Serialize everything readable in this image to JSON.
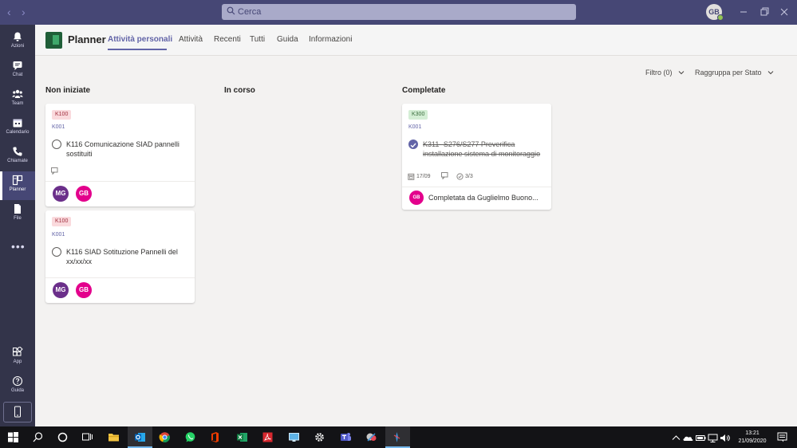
{
  "search": {
    "placeholder": "Cerca"
  },
  "user": {
    "initials": "GB"
  },
  "rail": {
    "items": [
      {
        "label": "Azioni",
        "icon": "bell-icon"
      },
      {
        "label": "Chat",
        "icon": "chat-icon"
      },
      {
        "label": "Team",
        "icon": "team-icon"
      },
      {
        "label": "Calendario",
        "icon": "calendar-icon"
      },
      {
        "label": "Chiamate",
        "icon": "phone-icon"
      },
      {
        "label": "Planner",
        "icon": "planner-icon"
      },
      {
        "label": "File",
        "icon": "file-icon"
      }
    ],
    "bottom": [
      {
        "label": "App",
        "icon": "apps-icon"
      },
      {
        "label": "Guida",
        "icon": "help-icon"
      }
    ]
  },
  "header": {
    "app_title": "Planner",
    "tabs": [
      "Attività personali",
      "Attività",
      "Recenti",
      "Tutti",
      "Guida",
      "Informazioni"
    ]
  },
  "toolbar": {
    "filter": "Filtro (0)",
    "group": "Raggruppa per Stato"
  },
  "columns": [
    "Non iniziate",
    "In corso",
    "Completate"
  ],
  "cards": [
    {
      "label": "K100",
      "bucket": "K001",
      "title": "K116 Comunicazione SIAD pannelli sostituiti",
      "assignees": [
        "MG",
        "GB"
      ]
    },
    {
      "label": "K100",
      "bucket": "K001",
      "title": "K116 SIAD Sotituzione Pannelli del xx/xx/xx",
      "assignees": [
        "MG",
        "GB"
      ]
    },
    {
      "label": "K300",
      "bucket": "K001",
      "title": "K311- S276/S277 Preverifica installazione sistema di monitoraggio",
      "due": "17/09",
      "checklist": "3/3",
      "completed_by_initials": "GB",
      "completed_by": "Completata da Guglielmo Buono..."
    }
  ],
  "taskbar": {
    "time": "13:21",
    "date": "21/09/2020"
  },
  "colors": {
    "accent": "#6264a7",
    "titlebar": "#464775",
    "rail": "#33344a"
  }
}
